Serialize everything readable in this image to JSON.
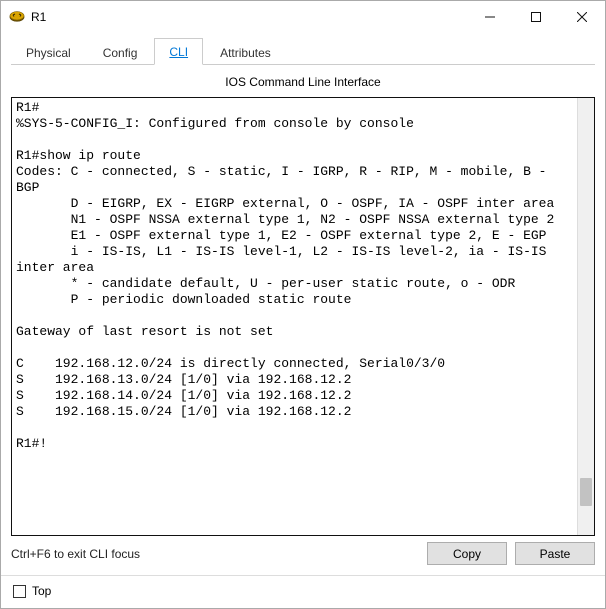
{
  "window": {
    "title": "R1"
  },
  "tabs": {
    "items": [
      {
        "label": "Physical"
      },
      {
        "label": "Config"
      },
      {
        "label": "CLI"
      },
      {
        "label": "Attributes"
      }
    ],
    "active_index": 2
  },
  "panel": {
    "title": "IOS Command Line Interface"
  },
  "terminal_lines": [
    "R1#",
    "%SYS-5-CONFIG_I: Configured from console by console",
    "",
    "R1#show ip route",
    "Codes: C - connected, S - static, I - IGRP, R - RIP, M - mobile, B - BGP",
    "       D - EIGRP, EX - EIGRP external, O - OSPF, IA - OSPF inter area",
    "       N1 - OSPF NSSA external type 1, N2 - OSPF NSSA external type 2",
    "       E1 - OSPF external type 1, E2 - OSPF external type 2, E - EGP",
    "       i - IS-IS, L1 - IS-IS level-1, L2 - IS-IS level-2, ia - IS-IS inter area",
    "       * - candidate default, U - per-user static route, o - ODR",
    "       P - periodic downloaded static route",
    "",
    "Gateway of last resort is not set",
    "",
    "C    192.168.12.0/24 is directly connected, Serial0/3/0",
    "S    192.168.13.0/24 [1/0] via 192.168.12.2",
    "S    192.168.14.0/24 [1/0] via 192.168.12.2",
    "S    192.168.15.0/24 [1/0] via 192.168.12.2",
    "",
    "R1#!"
  ],
  "below": {
    "hint": "Ctrl+F6 to exit CLI focus",
    "copy": "Copy",
    "paste": "Paste"
  },
  "footer": {
    "top_label": "Top"
  }
}
